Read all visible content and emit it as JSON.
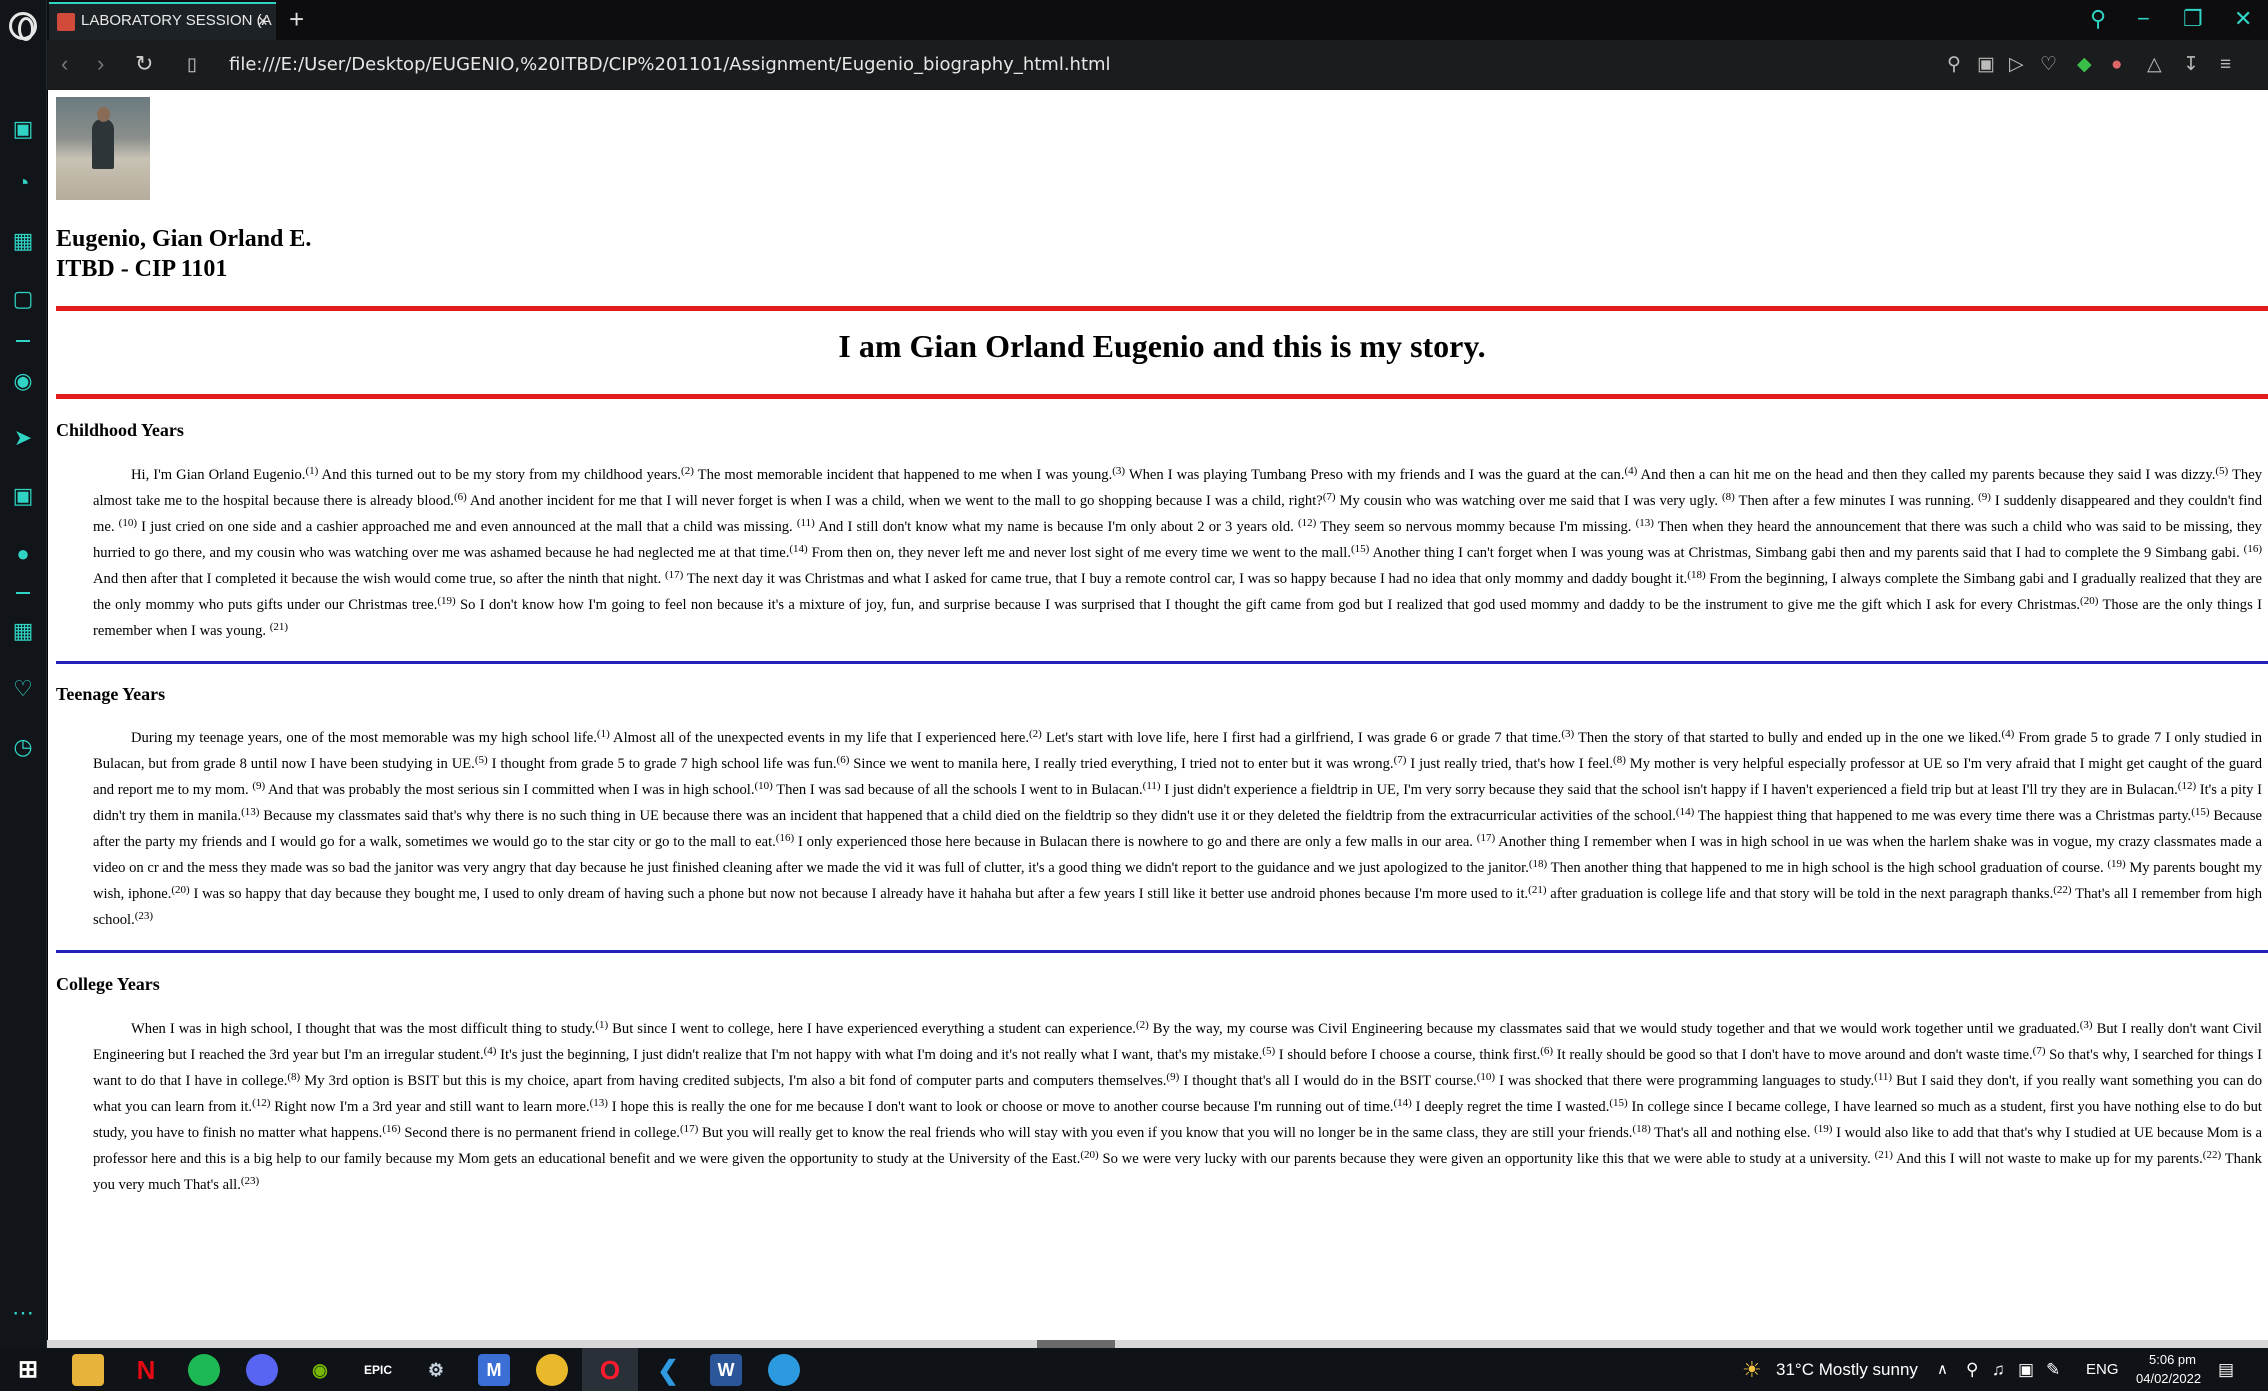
{
  "browser": {
    "tab_title": "LABORATORY SESSION (A",
    "tab_close": "×",
    "new_tab": "+",
    "url": "file:///E:/User/Desktop/EUGENIO,%20ITBD/CIP%201101/Assignment/Eugenio_biography_html.html"
  },
  "page": {
    "name": "Eugenio, Gian Orland E.",
    "course": "ITBD - CIP 1101",
    "title": "I am Gian Orland Eugenio and this is my story.",
    "sections": [
      {
        "heading": "Childhood Years",
        "html": "Hi, I'm Gian Orland Eugenio.<sup>(1)</sup> And this turned out to be my story from my childhood years.<sup>(2)</sup> The most memorable incident that happened to me when I was young.<sup>(3)</sup> When I was playing Tumbang Preso with my friends and I was the guard at the can.<sup>(4)</sup> And then a can hit me on the head and then they called my parents because they said I was dizzy.<sup>(5)</sup> They almost take me to the hospital because there is already blood.<sup>(6)</sup> And another incident for me that I will never forget is when I was a child, when we went to the mall to go shopping because I was a child, right?<sup>(7)</sup> My cousin who was watching over me said that I was very ugly. <sup>(8)</sup> Then after a few minutes I was running. <sup>(9)</sup> I suddenly disappeared and they couldn't find me. <sup>(10)</sup> I just cried on one side and a cashier approached me and even announced at the mall that a child was missing. <sup>(11)</sup> And I still don't know what my name is because I'm only about 2 or 3 years old. <sup>(12)</sup> They seem so nervous mommy because I'm missing. <sup>(13)</sup> Then when they heard the announcement that there was such a child who was said to be missing, they hurried to go there, and my cousin who was watching over me was ashamed because he had neglected me at that time.<sup>(14)</sup> From then on, they never left me and never lost sight of me every time we went to the mall.<sup>(15)</sup> Another thing I can't forget when I was young was at Christmas, Simbang gabi then and my parents said that I had to complete the 9 Simbang gabi. <sup>(16)</sup> And then after that I  completed it because the wish would come true, so after the ninth that night. <sup>(17)</sup> The next day it was Christmas and what I asked for came true, that I buy a remote control car, I was so happy because I had no idea that only mommy and daddy bought it.<sup>(18)</sup> From the beginning, I always complete the Simbang gabi and I gradually realized that they are the only mommy who puts gifts under our Christmas tree.<sup>(19)</sup> So I don't know how I'm going to feel non because it's a mixture of joy, fun, and surprise because I was surprised that I thought the gift came from god but I realized that god used mommy and daddy to be the instrument to give me the gift which I ask for every Christmas.<sup>(20)</sup> Those are the only things I remember when I was young. <sup>(21)</sup>"
      },
      {
        "heading": "Teenage Years",
        "html": "During my teenage years, one of the most memorable was my high school life.<sup>(1)</sup> Almost all of the unexpected events in my life that I experienced here.<sup>(2)</sup> Let's start with love life, here I first had a girlfriend, I was grade 6 or grade 7 that time.<sup>(3)</sup> Then the story of that started to bully and ended up in the one we liked.<sup>(4)</sup> From grade 5 to grade 7 I only studied in Bulacan, but from grade 8 until now I have been studying in UE.<sup>(5)</sup> I thought from grade 5 to grade 7 high school life was fun.<sup>(6)</sup> Since we went to manila here, I really tried everything, I tried not to enter but it was wrong.<sup>(7)</sup> I just really tried, that's how I feel.<sup>(8)</sup> My mother is very helpful especially professor at UE so I'm very afraid that I might get caught of the guard and report me to my mom. <sup>(9)</sup> And that was probably the most serious sin I committed when I was in high school.<sup>(10)</sup> Then I was sad because of all the schools I went to in Bulacan.<sup>(11)</sup> I just didn't experience a fieldtrip in UE, I'm very sorry because they said that the school isn't happy if I haven't experienced a field trip but at least I'll try they are in Bulacan.<sup>(12)</sup> It's a pity I didn't try them in manila.<sup>(13)</sup> Because my classmates said that's why there is no such thing in UE because there was an incident that happened that a child died on the fieldtrip so they didn't use it or they deleted the fieldtrip from the extracurricular activities of the school.<sup>(14)</sup> The happiest thing that happened to me was every time there was a Christmas party.<sup>(15)</sup> Because after the party my friends and I would go for a walk, sometimes we would go to the star city or go to the mall to eat.<sup>(16)</sup> I only experienced those here because in Bulacan there is nowhere to go and there are only a few malls in our area. <sup>(17)</sup> Another thing I remember when I was in high school in ue was when the harlem shake was in vogue, my crazy classmates made a video on cr and the mess they made was so bad the janitor was very angry that day because he just finished cleaning after we made the vid it was full of clutter, it's a good thing we didn't report to the guidance and we just apologized to the janitor.<sup>(18)</sup> Then another thing that happened to me in high school is the high school graduation of course. <sup>(19)</sup> My parents bought my wish, iphone.<sup>(20)</sup> I was so happy that day because they bought me, I used to only dream of having such a phone but now not because I already have it hahaha but after a few years I still like it better use android phones because I'm more used to it.<sup>(21)</sup> after graduation is college life and that story will be told in the next paragraph thanks.<sup>(22)</sup> That's all I remember from high school.<sup>(23)</sup>"
      },
      {
        "heading": "College Years",
        "html": "When I was in high school, I thought that was the most difficult thing to study.<sup>(1)</sup> But since I went to college, here I have experienced everything a student can experience.<sup>(2)</sup> By the way, my course was Civil Engineering because my classmates said that we would study together and that we would work together until we graduated.<sup>(3)</sup> But I really don't want Civil Engineering but I reached the 3rd year but I'm an irregular student.<sup>(4)</sup> It's just the beginning, I just didn't realize that I'm not happy with what I'm doing and it's not really what I want, that's my mistake.<sup>(5)</sup> I should before I choose a course, think first.<sup>(6)</sup> It really should be good so that I don't have to move around and don't waste time.<sup>(7)</sup> So that's why, I searched for things I want to do that I have in college.<sup>(8)</sup> My 3rd option is BSIT but this is my choice, apart from having credited subjects, I'm also a bit fond of computer parts and computers themselves.<sup>(9)</sup> I thought that's all I would do in the BSIT course.<sup>(10)</sup> I was shocked that there were programming languages to study.<sup>(11)</sup> But I said they don't, if you really want something you can do what you can learn from it.<sup>(12)</sup> Right now I'm a 3rd year and still want to learn more.<sup>(13)</sup> I hope this is really the one for me because I don't want to look or choose or move to another course because I'm running out of time.<sup>(14)</sup> I deeply regret the time I wasted.<sup>(15)</sup> In college since I became college, I have learned so much as a student, first you have nothing else to do but study, you have to finish no matter what happens.<sup>(16)</sup> Second there is no permanent friend in college.<sup>(17)</sup> But you will really get to know the real friends who will stay with you even if you know that you will no longer be in the same class, they are still your friends.<sup>(18)</sup> That's all and nothing else. <sup>(19)</sup> I would also like to add that that's why I studied at UE because Mom is a professor here and this is a big help to our family because my Mom gets an educational benefit and we were given the opportunity to study at the University of the East.<sup>(20)</sup> So we were very lucky with our parents because they were given an opportunity like this that we were able to study at a university. <sup>(21)</sup> And this I will not waste to make up for my parents.<sup>(22)</sup> Thank you very much That's all.<sup>(23)</sup>"
      }
    ]
  },
  "taskbar": {
    "weather": "31°C  Mostly sunny",
    "language": "ENG",
    "time": "5:06 pm",
    "date": "04/02/2022"
  },
  "colors": {
    "accent": "#2fd4c4",
    "red_rule": "#e41b1b",
    "blue_rule": "#2222bb"
  }
}
